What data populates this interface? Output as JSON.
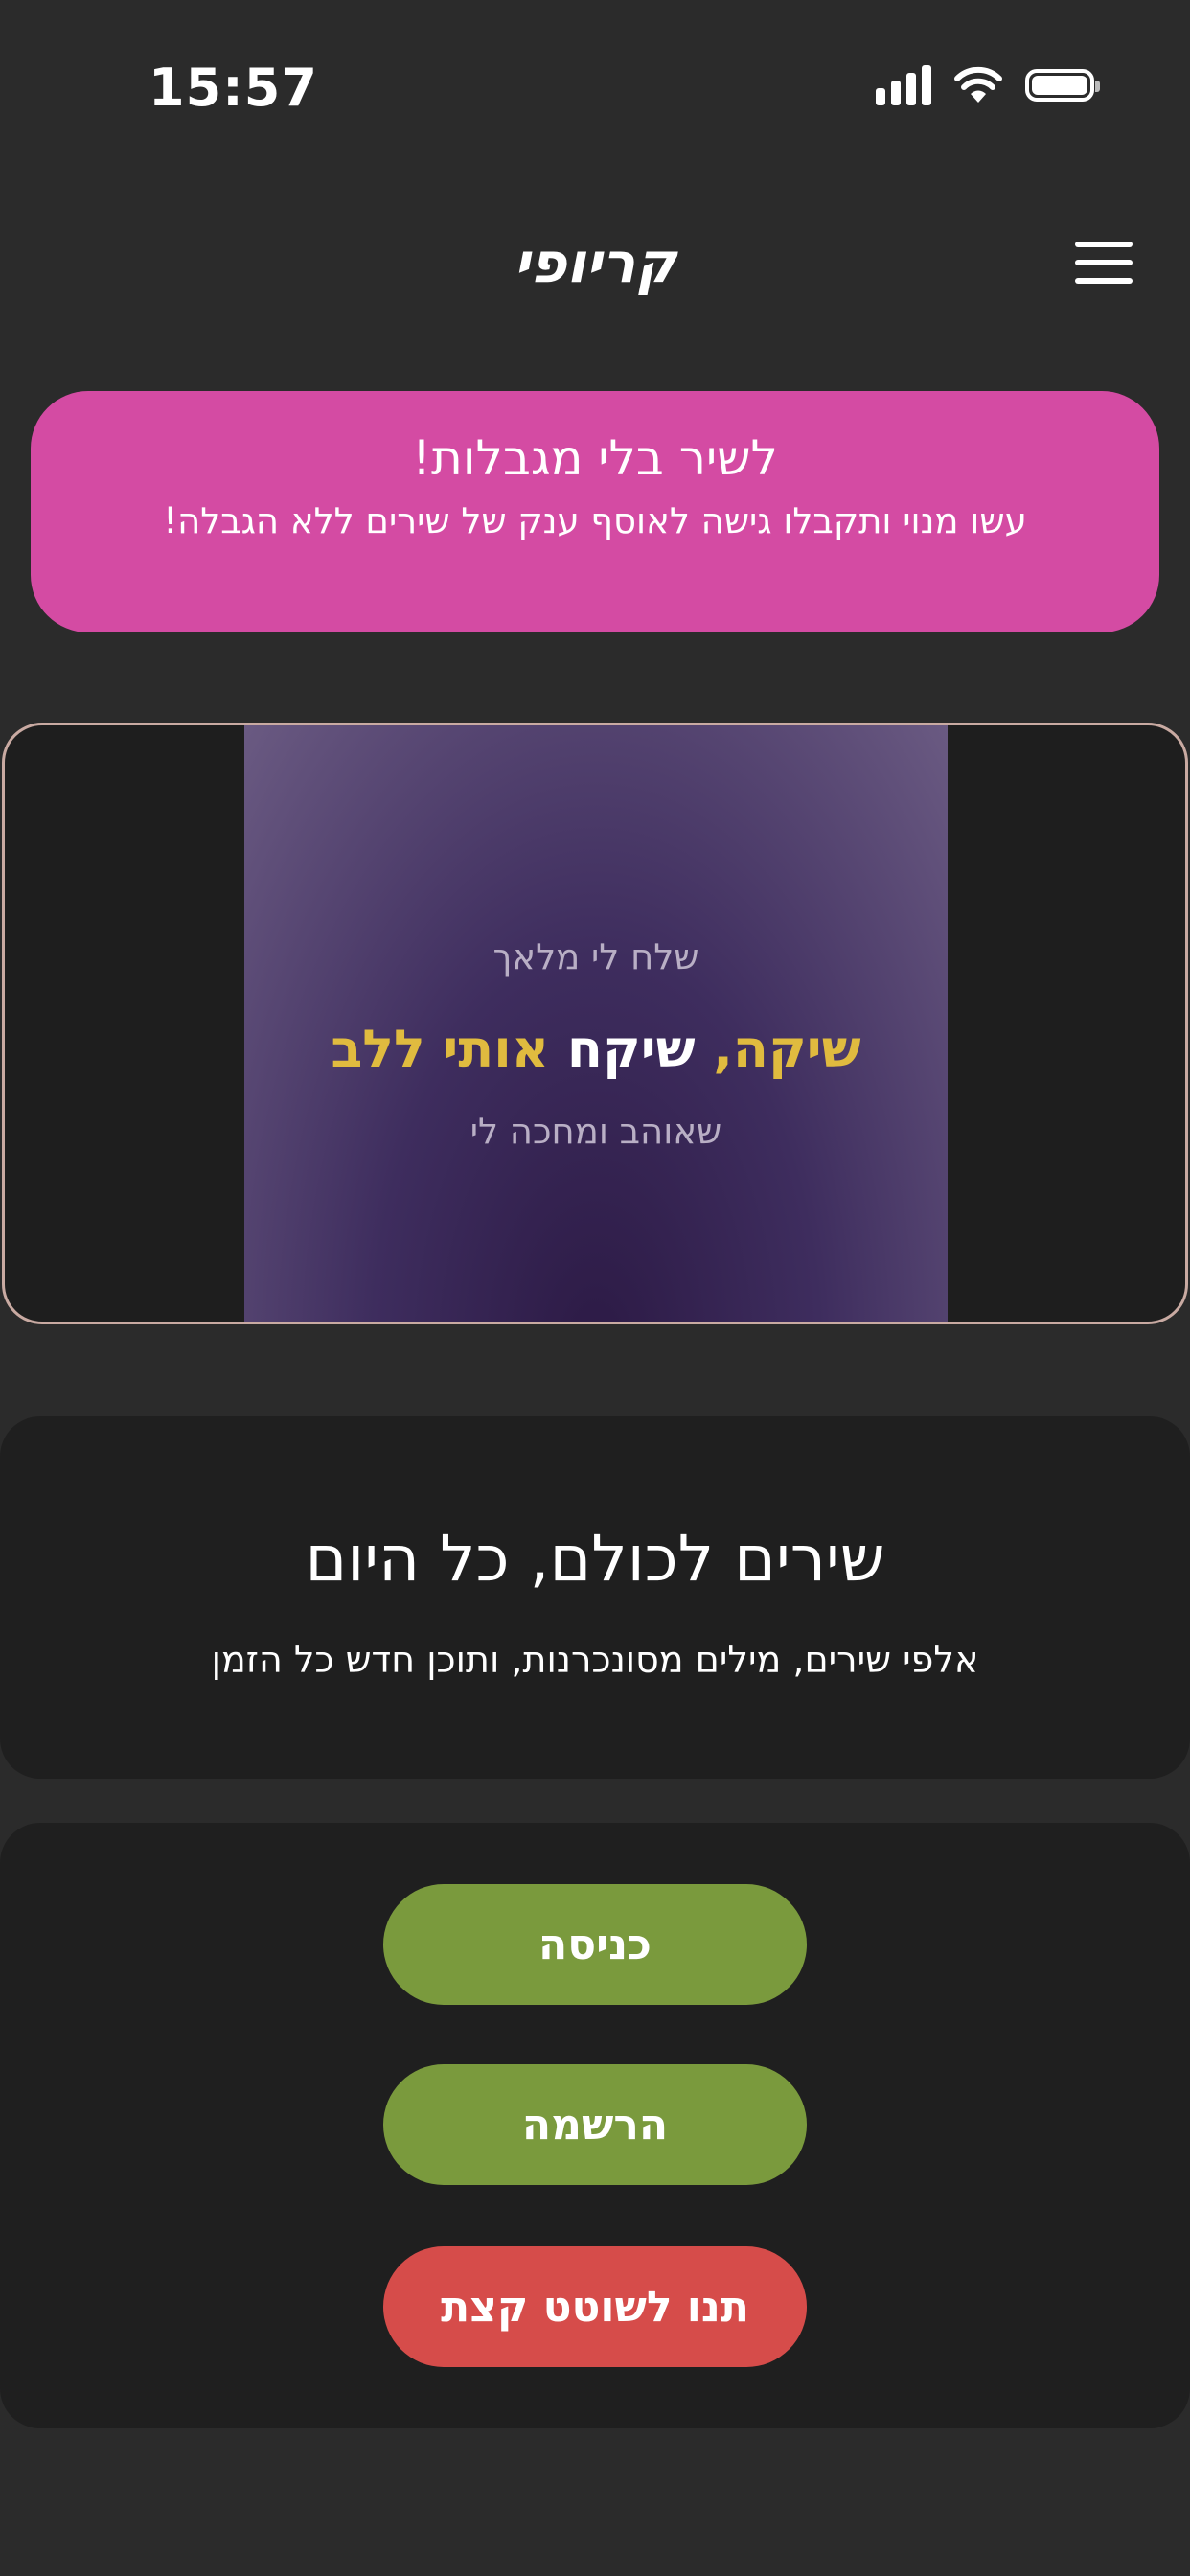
{
  "status_bar": {
    "time": "15:57",
    "icons": [
      "signal-icon",
      "wifi-icon",
      "battery-icon"
    ]
  },
  "header": {
    "title": "קריופי",
    "menu_icon": "hamburger-menu-icon"
  },
  "promo": {
    "title": "לשיר בלי מגבלות!",
    "subtitle": "עשו מנוי ותקבלו גישה לאוסף ענק של שירים ללא הגבלה!"
  },
  "video": {
    "previous_line": "שלח לי מלאך",
    "current_line": {
      "sung": "שיקה,",
      "current_word": "שיקח",
      "upcoming": "אותי ללב"
    },
    "next_line": "שאוהב ומחכה לי"
  },
  "tagline": {
    "title": "שירים לכולם, כל היום",
    "subtitle": "אלפי שירים, מילים מסונכרנות, ותוכן חדש כל הזמן"
  },
  "actions": {
    "login_label": "כניסה",
    "register_label": "הרשמה",
    "play_label": "תנו לשוטט קצת"
  },
  "colors": {
    "background": "#2b2b2b",
    "card": "#1f1f1f",
    "promo": "#d44ba3",
    "primary_button": "#7a9a3d",
    "secondary_button": "#d64c4a",
    "lyric_highlight": "#e0bb3f"
  }
}
